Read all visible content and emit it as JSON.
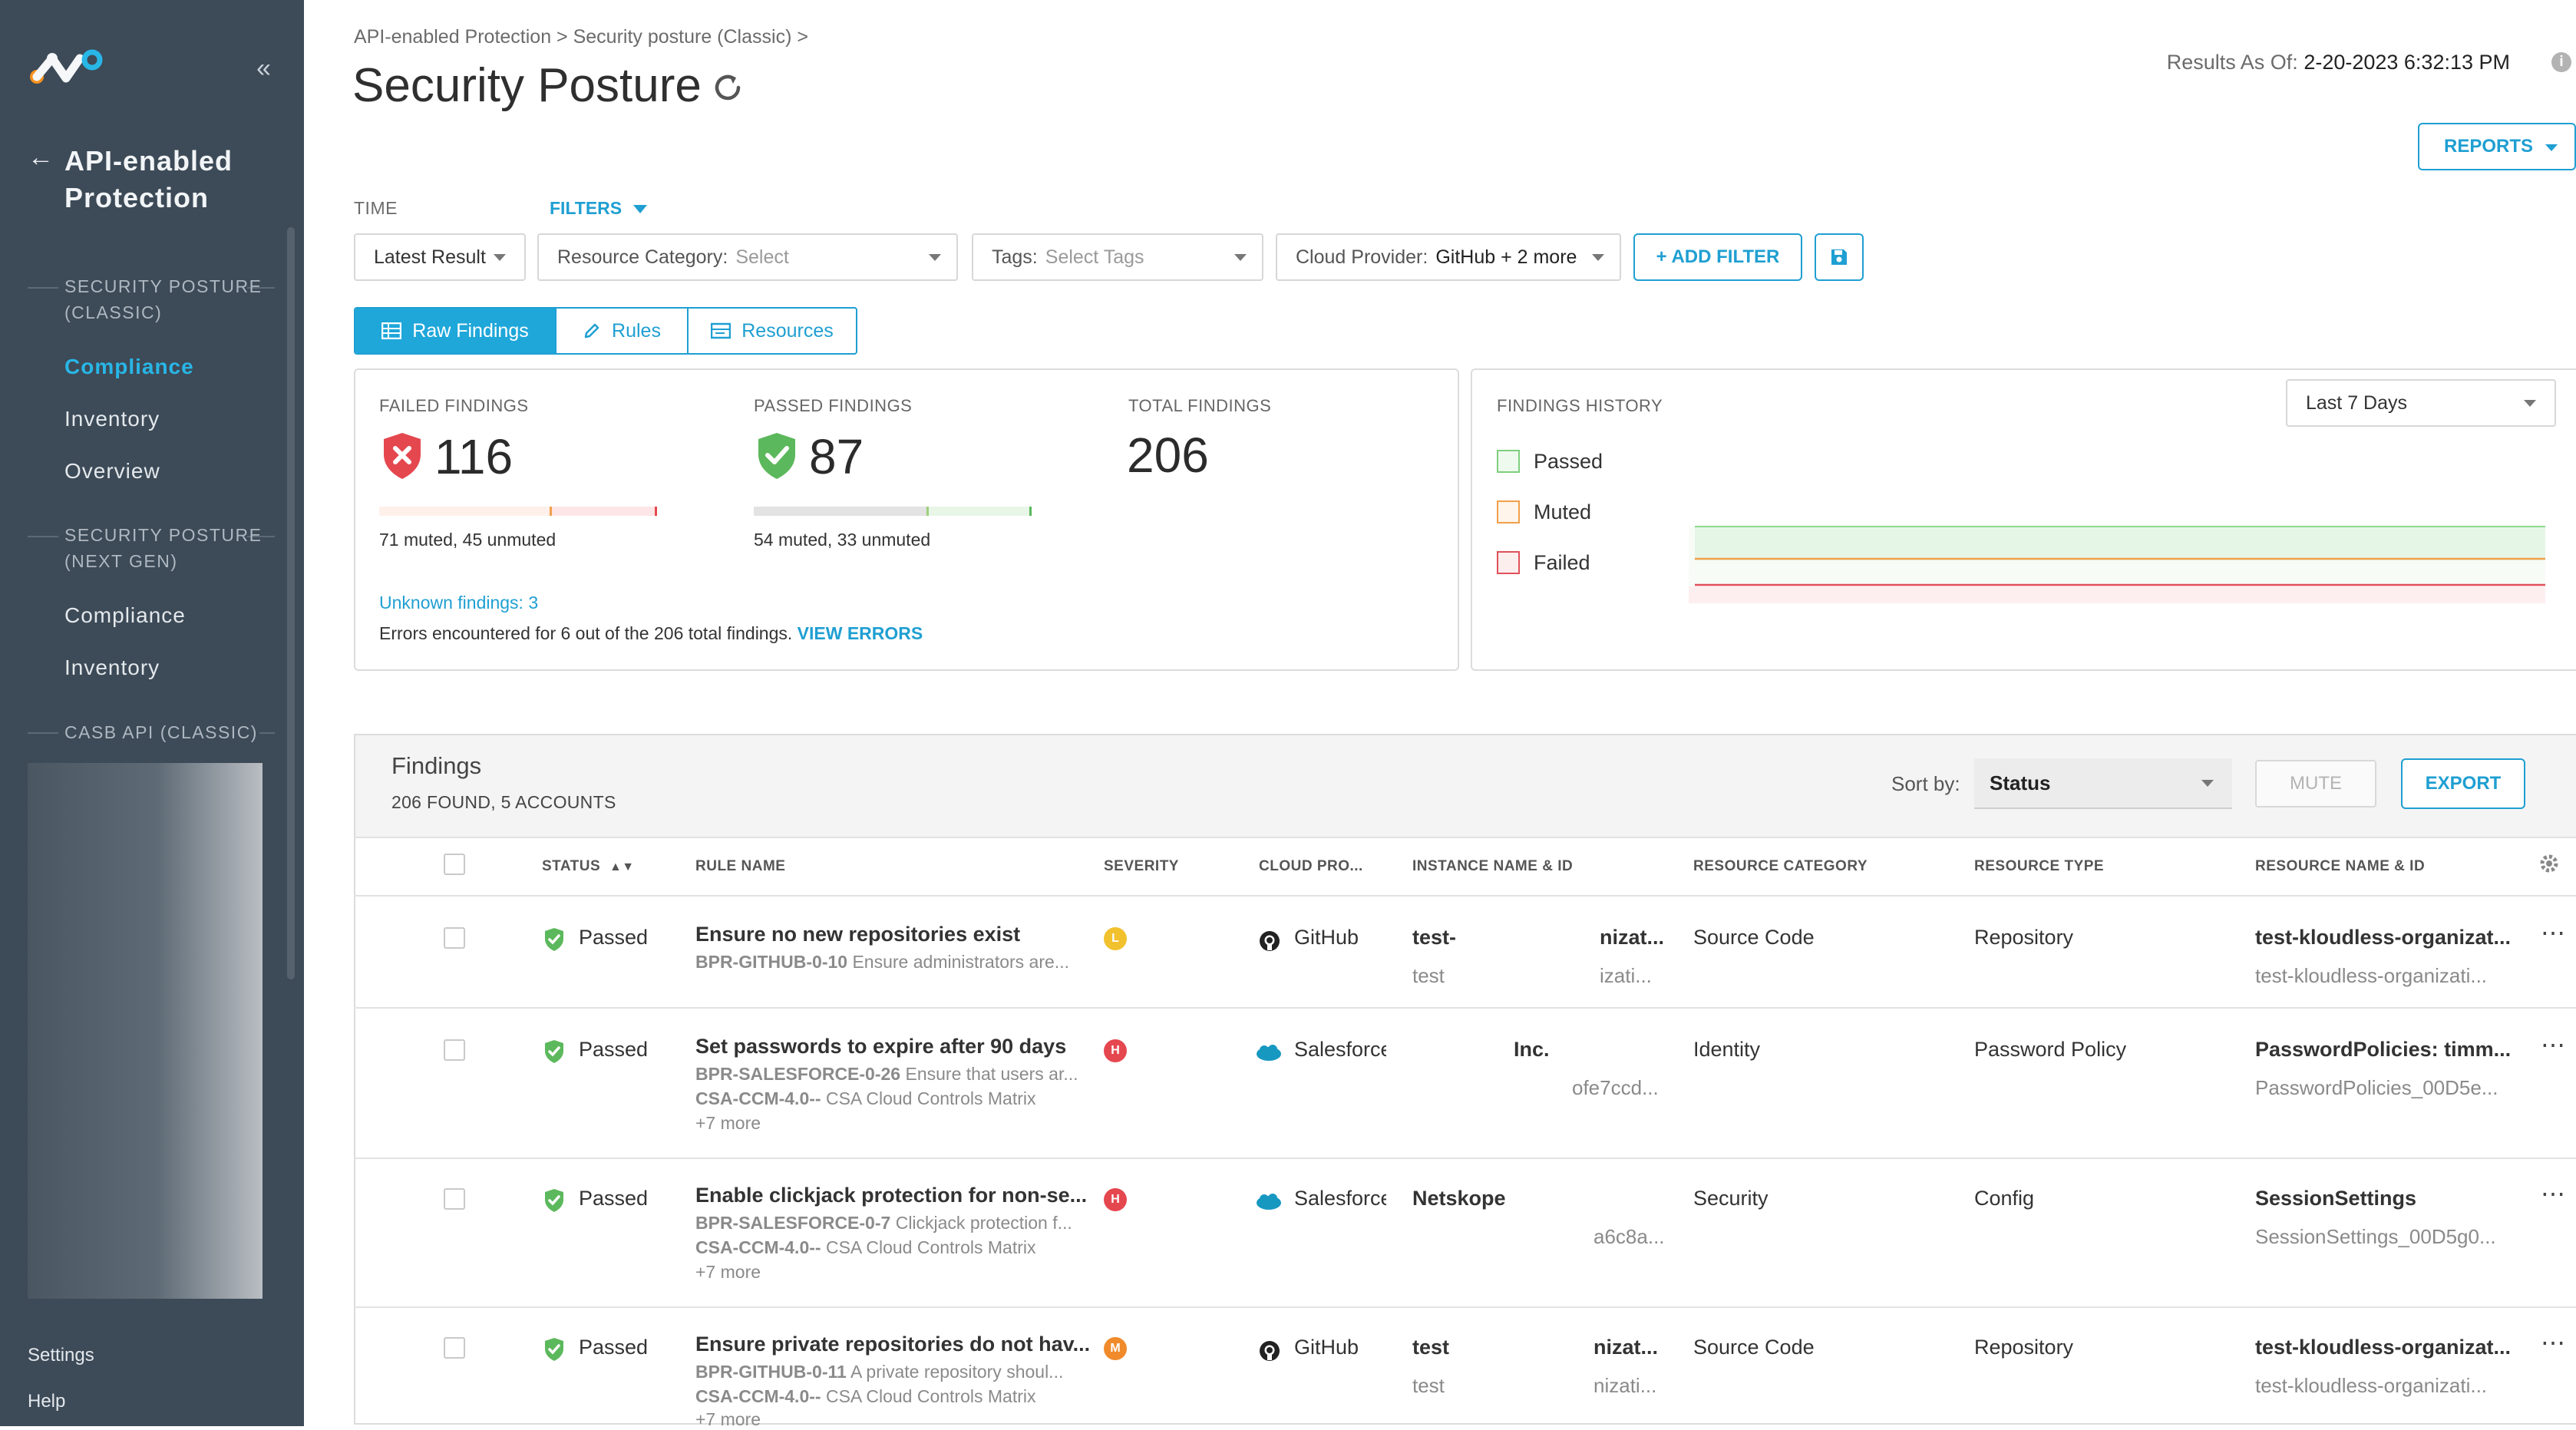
{
  "sidebar": {
    "back_title_line1": "API-enabled",
    "back_title_line2": "Protection",
    "section1": {
      "line1": "SECURITY POSTURE",
      "line2": "(CLASSIC)"
    },
    "section1_items": [
      "Compliance",
      "Inventory",
      "Overview"
    ],
    "section2": {
      "line1": "SECURITY POSTURE",
      "line2": "(NEXT GEN)"
    },
    "section2_items": [
      "Compliance",
      "Inventory"
    ],
    "section3": "CASB API (CLASSIC)",
    "settings": "Settings",
    "help": "Help"
  },
  "header": {
    "breadcrumb": "API-enabled Protection > Security posture (Classic) >",
    "title": "Security Posture",
    "results_label": "Results As Of:",
    "results_value": "2-20-2023 6:32:13 PM",
    "reports_button": "REPORTS"
  },
  "filters": {
    "time_label": "TIME",
    "filters_label": "FILTERS",
    "time_value": "Latest Result",
    "resource_category_label": "Resource Category:",
    "resource_category_value": "Select",
    "tags_label": "Tags:",
    "tags_value": "Select Tags",
    "cloud_provider_label": "Cloud Provider:",
    "cloud_provider_value": "GitHub + 2 more",
    "add_filter": "+ ADD FILTER"
  },
  "view_tabs": [
    "Raw Findings",
    "Rules",
    "Resources"
  ],
  "summary": {
    "failed_label": "FAILED FINDINGS",
    "failed_value": "116",
    "failed_detail": "71 muted, 45 unmuted",
    "failed_muted_fraction": 0.612,
    "passed_label": "PASSED FINDINGS",
    "passed_value": "87",
    "passed_detail": "54 muted, 33 unmuted",
    "passed_muted_fraction": 0.621,
    "total_label": "TOTAL FINDINGS",
    "total_value": "206",
    "unknown_label": "Unknown findings:",
    "unknown_value": "3",
    "errors_text": "Errors encountered for 6 out of the 206 total findings.",
    "view_errors": "VIEW ERRORS"
  },
  "history": {
    "label": "FINDINGS HISTORY",
    "range": "Last 7 Days",
    "legend": [
      "Passed",
      "Muted",
      "Failed"
    ],
    "colors": {
      "passed": "#7ecf7e",
      "muted": "#f0a04b",
      "failed": "#e0505a"
    }
  },
  "findings": {
    "title": "Findings",
    "count": "206 FOUND, 5 ACCOUNTS",
    "sort_label": "Sort by:",
    "sort_value": "Status",
    "mute_button": "MUTE",
    "export_button": "EXPORT",
    "columns": [
      "STATUS",
      "RULE NAME",
      "SEVERITY",
      "CLOUD PRO...",
      "INSTANCE NAME & ID",
      "RESOURCE CATEGORY",
      "RESOURCE TYPE",
      "RESOURCE NAME & ID"
    ],
    "rows": [
      {
        "status": "Passed",
        "rule": "Ensure no new repositories exist",
        "rule_id": "BPR-GITHUB-0-10",
        "rule_desc": "Ensure administrators are...",
        "rule_extra1_id": "",
        "rule_extra1_desc": "",
        "rule_more": "",
        "severity": "L",
        "severity_color": "#f2c12e",
        "provider": "GitHub",
        "instance": "test-",
        "instance_tail": "nizat...",
        "instance_sub": "test",
        "instance_sub_tail": "izati...",
        "category": "Source Code",
        "type": "Repository",
        "resource": "test-kloudless-organizat...",
        "resource_sub": "test-kloudless-organizati..."
      },
      {
        "status": "Passed",
        "rule": "Set passwords to expire after 90 days",
        "rule_id": "BPR-SALESFORCE-0-26",
        "rule_desc": "Ensure that users ar...",
        "rule_extra1_id": "CSA-CCM-4.0--",
        "rule_extra1_desc": "CSA Cloud Controls Matrix",
        "rule_more": "+7 more",
        "severity": "H",
        "severity_color": "#e5474f",
        "provider": "Salesforce",
        "instance": "",
        "instance_tail": "Inc.",
        "instance_sub": "",
        "instance_sub_tail": "ofe7ccd...",
        "category": "Identity",
        "type": "Password Policy",
        "resource": "PasswordPolicies: timm...",
        "resource_sub": "PasswordPolicies_00D5e..."
      },
      {
        "status": "Passed",
        "rule": "Enable clickjack protection for non-se...",
        "rule_id": "BPR-SALESFORCE-0-7",
        "rule_desc": "Clickjack protection f...",
        "rule_extra1_id": "CSA-CCM-4.0--",
        "rule_extra1_desc": "CSA Cloud Controls Matrix",
        "rule_more": "+7 more",
        "severity": "H",
        "severity_color": "#e5474f",
        "provider": "Salesforce",
        "instance": "Netskope",
        "instance_tail": "",
        "instance_sub": "",
        "instance_sub_tail": "a6c8a...",
        "category": "Security",
        "type": "Config",
        "resource": "SessionSettings",
        "resource_sub": "SessionSettings_00D5g0..."
      },
      {
        "status": "Passed",
        "rule": "Ensure private repositories do not hav...",
        "rule_id": "BPR-GITHUB-0-11",
        "rule_desc": "A private repository shoul...",
        "rule_extra1_id": "CSA-CCM-4.0--",
        "rule_extra1_desc": "CSA Cloud Controls Matrix",
        "rule_more": "+7 more",
        "severity": "M",
        "severity_color": "#f08a2b",
        "provider": "GitHub",
        "instance": "test",
        "instance_tail": "nizat...",
        "instance_sub": "test",
        "instance_sub_tail": "nizati...",
        "category": "Source Code",
        "type": "Repository",
        "resource": "test-kloudless-organizat...",
        "resource_sub": "test-kloudless-organizati..."
      }
    ]
  }
}
